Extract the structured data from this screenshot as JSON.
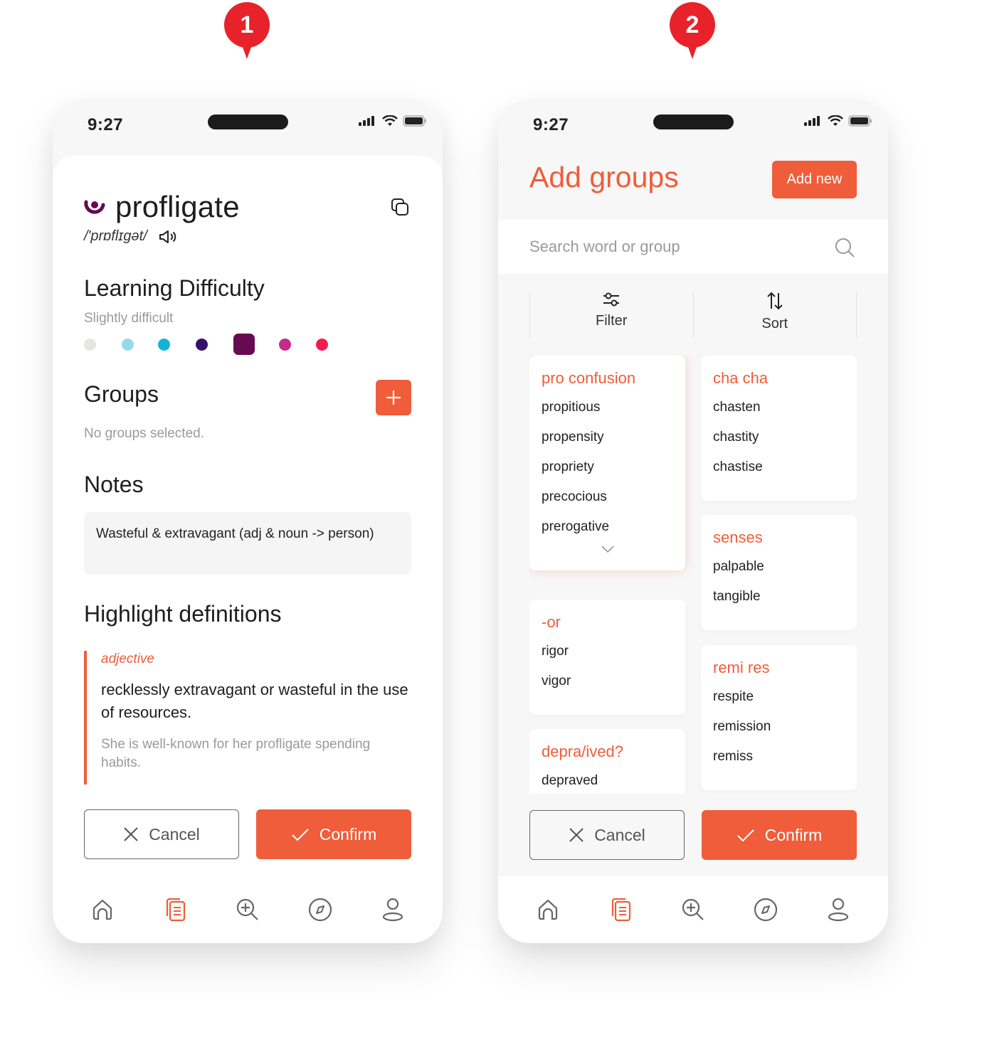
{
  "markers": [
    "1",
    "2"
  ],
  "status": {
    "time": "9:27"
  },
  "screen1": {
    "word": "profligate",
    "phonetic": "/'prɒflɪgət/",
    "difficulty": {
      "heading": "Learning Difficulty",
      "label": "Slightly difficult",
      "levels": [
        {
          "color": "#e8e4e2"
        },
        {
          "color": "#93dbea"
        },
        {
          "color": "#13b3d8"
        },
        {
          "color": "#36116b"
        },
        {
          "color": "#660a52",
          "selected": true
        },
        {
          "color": "#c62a8a"
        },
        {
          "color": "#f41c4e"
        }
      ],
      "selected_index": 4
    },
    "groups": {
      "heading": "Groups",
      "empty": "No groups selected."
    },
    "notes": {
      "heading": "Notes",
      "text": "Wasteful & extravagant (adj & noun -> person)"
    },
    "highlight": {
      "heading": "Highlight definitions",
      "pos": "adjective",
      "definition": "recklessly extravagant or wasteful in the use of resources.",
      "example": "She is well-known for her profligate spending habits."
    },
    "cancel_label": "Cancel",
    "confirm_label": "Confirm"
  },
  "screen2": {
    "title": "Add groups",
    "add_new_label": "Add new",
    "search_placeholder": "Search word or group",
    "filter_label": "Filter",
    "sort_label": "Sort",
    "groups_left": [
      {
        "title": "pro confusion",
        "words": [
          "propitious",
          "propensity",
          "propriety",
          "precocious",
          "prerogative"
        ],
        "expandable": true,
        "active": true
      },
      {
        "title": "-or",
        "words": [
          "rigor",
          "vigor"
        ]
      },
      {
        "title": "depra/ived?",
        "words": [
          "depraved"
        ]
      }
    ],
    "groups_right": [
      {
        "title": "cha cha",
        "words": [
          "chasten",
          "chastity",
          "chastise"
        ]
      },
      {
        "title": "senses",
        "words": [
          "palpable",
          "tangible"
        ]
      },
      {
        "title": "remi res",
        "words": [
          "respite",
          "remission",
          "remiss"
        ]
      }
    ],
    "cancel_label": "Cancel",
    "confirm_label": "Confirm"
  },
  "tabbar": {
    "items": [
      {
        "icon": "home-icon"
      },
      {
        "icon": "cards-icon",
        "active": true
      },
      {
        "icon": "zoom-in-icon"
      },
      {
        "icon": "compass-icon"
      },
      {
        "icon": "profile-icon"
      }
    ]
  },
  "colors": {
    "accent": "#ef5d3a",
    "marker": "#e8222a"
  }
}
